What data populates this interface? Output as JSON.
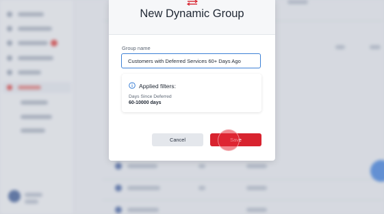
{
  "modal": {
    "title": "New Dynamic Group",
    "header_icon": "swap-arrows-icon",
    "group_name": {
      "label": "Group name",
      "value": "Customers with Deferred Services 60+ Days Ago"
    },
    "applied_filters": {
      "title": "Applied filters:",
      "icon": "info-icon",
      "filters": [
        {
          "name": "Days Since Deferred",
          "value": "60-10000 days"
        }
      ]
    },
    "buttons": {
      "cancel_label": "Cancel",
      "save_label": "Save"
    }
  },
  "colors": {
    "primary_red": "#d8232f",
    "input_focus_blue": "#3a7fd5",
    "cancel_gray": "#e4e7ec"
  }
}
